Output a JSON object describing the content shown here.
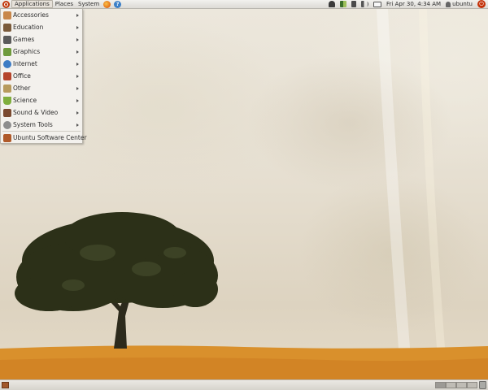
{
  "top_panel": {
    "menus": {
      "applications": "Applications",
      "places": "Places",
      "system": "System"
    },
    "clock": "Fri Apr 30,  4:34 AM",
    "user": "ubuntu",
    "icons": [
      "ubuntu-logo",
      "firefox-icon",
      "help-icon",
      "account-icon",
      "network-icon",
      "battery-icon",
      "volume-icon",
      "mail-icon",
      "user-icon",
      "power-icon"
    ]
  },
  "app_menu": {
    "items": [
      {
        "label": "Accessories",
        "icon": "accessories-icon",
        "color": "#c8874a"
      },
      {
        "label": "Education",
        "icon": "education-icon",
        "color": "#7a5a3a"
      },
      {
        "label": "Games",
        "icon": "games-icon",
        "color": "#5a5a5a"
      },
      {
        "label": "Graphics",
        "icon": "graphics-icon",
        "color": "#6f9a3c"
      },
      {
        "label": "Internet",
        "icon": "internet-icon",
        "color": "#3d7cc4"
      },
      {
        "label": "Office",
        "icon": "office-icon",
        "color": "#b5452b"
      },
      {
        "label": "Other",
        "icon": "other-icon",
        "color": "#b79a5c"
      },
      {
        "label": "Science",
        "icon": "science-icon",
        "color": "#7fae3d"
      },
      {
        "label": "Sound & Video",
        "icon": "sound-video-icon",
        "color": "#7a4a30"
      },
      {
        "label": "System Tools",
        "icon": "system-tools-icon",
        "color": "#8d8d8d"
      },
      {
        "label": "Ubuntu Software Center",
        "icon": "software-center-icon",
        "color": "#b05a2a"
      }
    ]
  },
  "bottom_panel": {
    "icons": [
      "show-desktop-icon",
      "workspace-switcher",
      "trash-icon"
    ]
  },
  "colors": {
    "panel": "#dcdad5",
    "menu_bg": "#f3f1ed",
    "tree": "#2c3018",
    "field": "#d9902c"
  }
}
